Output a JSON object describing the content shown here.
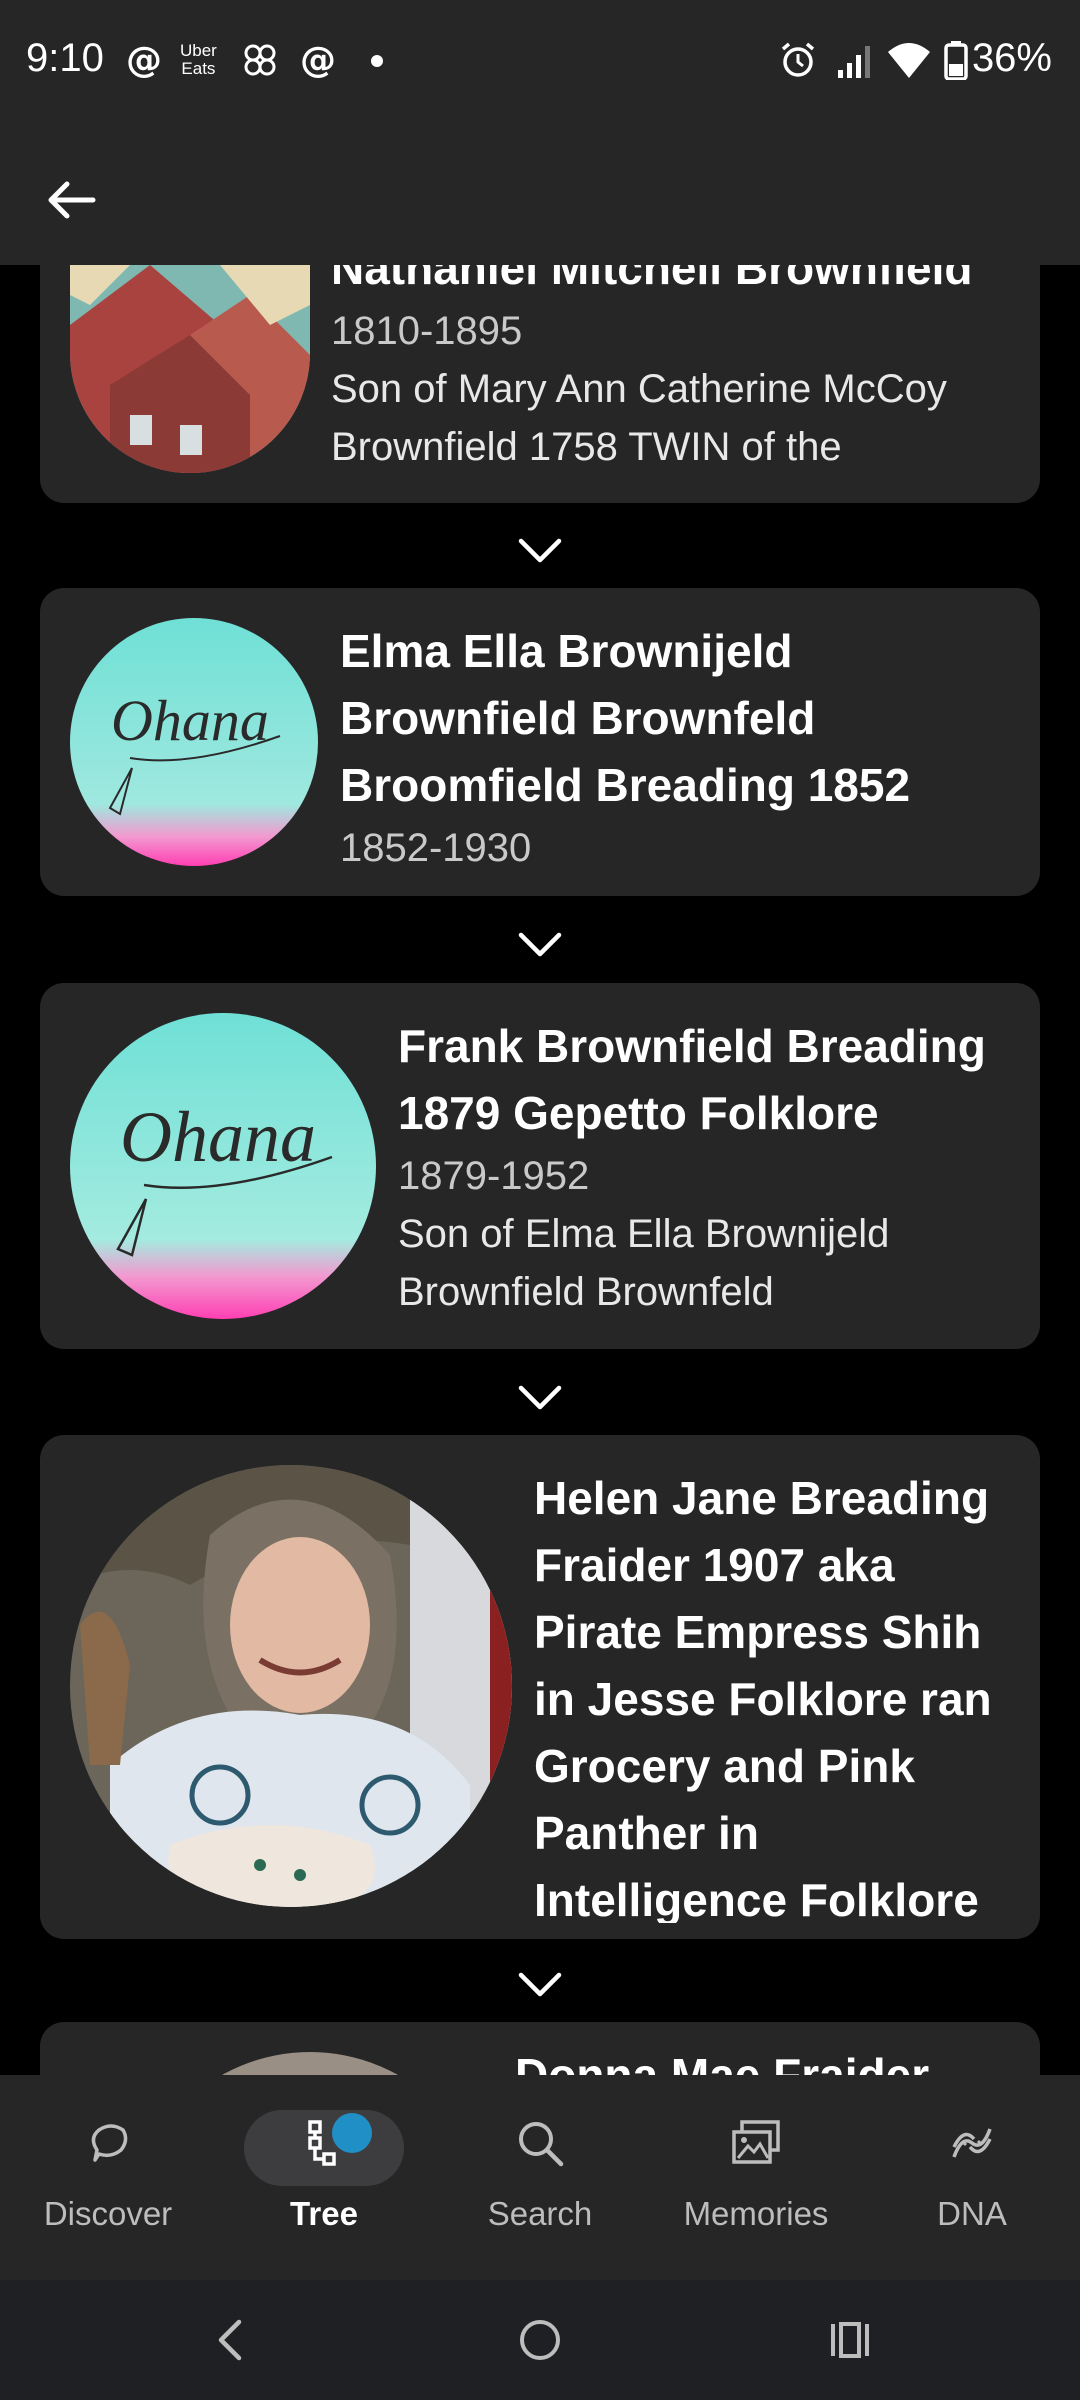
{
  "status_bar": {
    "time": "9:10",
    "battery": "36%",
    "left_icons": [
      "threads-icon",
      "uber-eats-icon",
      "pinwheel-icon",
      "threads-icon",
      "dot-icon"
    ],
    "uber_eats_text_1": "Uber",
    "uber_eats_text_2": "Eats",
    "right_icons": [
      "alarm-icon",
      "signal-icon",
      "wifi-icon",
      "battery-icon"
    ]
  },
  "header": {
    "back_icon": "arrow-left-icon"
  },
  "cards": [
    {
      "name": "Nathaniel Mitchell Brownfield",
      "dates": "1810-1895",
      "desc_line1": "Son of Mary Ann Catherine McCoy",
      "desc_line2": "Brownfield 1758 TWIN of the"
    },
    {
      "name_line1": "Elma Ella Brownijeld",
      "name_line2": "Brownfield Brownfeld",
      "name_line3": "Broomfield Breading 1852",
      "dates": "1852-1930",
      "image_text": "Ohana"
    },
    {
      "name_line1": "Frank Brownfield Breading",
      "name_line2": "1879 Gepetto Folklore",
      "dates": "1879-1952",
      "desc_line1": "Son of Elma Ella Brownijeld",
      "desc_line2": "Brownfield Brownfeld",
      "image_text": "Ohana"
    },
    {
      "name_line1": "Helen Jane Breading",
      "name_line2": "Fraider 1907 aka",
      "name_line3": "Pirate Empress Shih",
      "name_line4": "in Jesse Folklore ran",
      "name_line5": "Grocery and Pink",
      "name_line6": "Panther in",
      "name_line7": "Intelligence Folklore"
    },
    {
      "name": "Donna Mae Fraider"
    }
  ],
  "bottom_nav": {
    "items": [
      {
        "label": "Discover",
        "icon": "discover-icon"
      },
      {
        "label": "Tree",
        "icon": "tree-icon",
        "active": true
      },
      {
        "label": "Search",
        "icon": "search-icon"
      },
      {
        "label": "Memories",
        "icon": "memories-icon"
      },
      {
        "label": "DNA",
        "icon": "dna-icon"
      }
    ]
  },
  "colors": {
    "background": "#000000",
    "card": "#262627",
    "accent_dot": "#1f8fc6",
    "text_secondary": "#c9c9c9"
  }
}
